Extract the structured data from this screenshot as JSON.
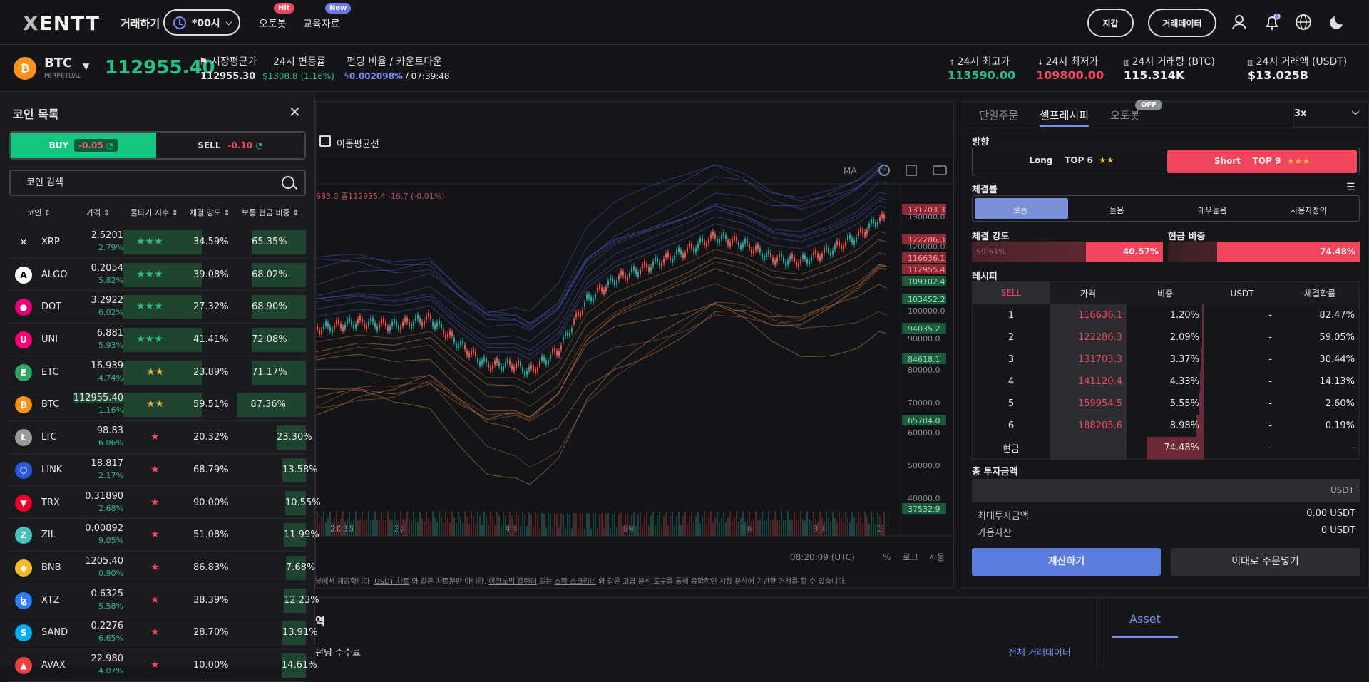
{
  "nav": {
    "logo_x": "X",
    "logo_text": "ENTT",
    "trade": "거래하기",
    "hour": "*00시",
    "autobot": "오토봇",
    "autobot_badge": "Hit",
    "edu": "교육자료",
    "edu_badge": "New",
    "wallet": "지갑",
    "tradedata": "거래데이터"
  },
  "ticker": {
    "symbol": "BTC",
    "sub": "PERPETUAL",
    "last": "112955.40",
    "mark_label": "시장평균가",
    "mark_value": "112955.30",
    "chg_label": "24시 변동률",
    "chg_value": "$1308.8 (1.16%)",
    "funding_label": "펀딩 비율 / 카운트다운",
    "funding_rate": "0.002098%",
    "funding_count": "/ 07:39:48",
    "high_label": "24시 최고가",
    "high_value": "113590.00",
    "low_label": "24시 최저가",
    "low_value": "109800.00",
    "vol_btc_label": "24시 거래량 (BTC)",
    "vol_btc_value": "115.314K",
    "vol_usdt_label": "24시 거래액 (USDT)",
    "vol_usdt_value": "$13.025B"
  },
  "coinlist": {
    "title": "코인 목록",
    "buy": "BUY",
    "buy_chip": "-0.05",
    "sell": "SELL",
    "sell_chip": "-0.10",
    "search_placeholder": "코인 검색",
    "headers": [
      "코인 ⇕",
      "가격 ⇕",
      "물타기 지수 ⇕",
      "체결 강도 ⇕",
      "보통 현금 비중 ⇕"
    ],
    "rows": [
      {
        "name": "XRP",
        "price": "2.5201",
        "pct": "2.79%",
        "stars": "★★★",
        "strength": "34.59%",
        "cash": "65.35%",
        "icon": "✕",
        "color": "#1a1b1f",
        "starcolor": "#2ebd85",
        "cashw": 0.62
      },
      {
        "name": "ALGO",
        "price": "0.2054",
        "pct": "5.82%",
        "stars": "★★★",
        "strength": "39.08%",
        "cash": "68.02%",
        "icon": "A",
        "color": "#ffffff",
        "starcolor": "#2ebd85",
        "cashw": 0.62
      },
      {
        "name": "DOT",
        "price": "3.2922",
        "pct": "6.02%",
        "stars": "★★★",
        "strength": "27.32%",
        "cash": "68.90%",
        "icon": "●",
        "color": "#e6007a",
        "starcolor": "#2ebd85",
        "cashw": 0.62
      },
      {
        "name": "UNI",
        "price": "6.881",
        "pct": "5.93%",
        "stars": "★★★",
        "strength": "41.41%",
        "cash": "72.08%",
        "icon": "U",
        "color": "#ff007a",
        "starcolor": "#2ebd85",
        "cashw": 0.62
      },
      {
        "name": "ETC",
        "price": "16.939",
        "pct": "4.74%",
        "stars": "★★",
        "strength": "23.89%",
        "cash": "71.17%",
        "icon": "E",
        "color": "#33a466",
        "starcolor": "#e8b64a",
        "cashw": 0.62
      },
      {
        "name": "BTC",
        "price": "112955.40",
        "pct": "1.16%",
        "stars": "★★",
        "strength": "59.51%",
        "cash": "87.36%",
        "icon": "₿",
        "color": "#f7931a",
        "starcolor": "#e8b64a",
        "cashw": 0.85
      },
      {
        "name": "LTC",
        "price": "98.83",
        "pct": "6.06%",
        "stars": "★",
        "strength": "20.32%",
        "cash": "23.30%",
        "icon": "Ł",
        "color": "#9a9a9a",
        "starcolor": "#f6465d",
        "cashw": 0.23
      },
      {
        "name": "LINK",
        "price": "18.817",
        "pct": "2.17%",
        "stars": "★",
        "strength": "68.79%",
        "cash": "13.58%",
        "icon": "⬡",
        "color": "#2a5ada",
        "starcolor": "#f6465d",
        "cashw": 0.14
      },
      {
        "name": "TRX",
        "price": "0.31890",
        "pct": "2.68%",
        "stars": "★",
        "strength": "90.00%",
        "cash": "10.55%",
        "icon": "▼",
        "color": "#eb0029",
        "starcolor": "#f6465d",
        "cashw": 0.1
      },
      {
        "name": "ZIL",
        "price": "0.00892",
        "pct": "9.05%",
        "stars": "★",
        "strength": "51.08%",
        "cash": "11.99%",
        "icon": "Z",
        "color": "#49c1bf",
        "starcolor": "#f6465d",
        "cashw": 0.12
      },
      {
        "name": "BNB",
        "price": "1205.40",
        "pct": "0.90%",
        "stars": "★",
        "strength": "86.83%",
        "cash": "7.68%",
        "icon": "◆",
        "color": "#f3ba2f",
        "starcolor": "#f6465d",
        "cashw": 0.07
      },
      {
        "name": "XTZ",
        "price": "0.6325",
        "pct": "5.58%",
        "stars": "★",
        "strength": "38.39%",
        "cash": "12.23%",
        "icon": "ꜩ",
        "color": "#2c7df7",
        "starcolor": "#f6465d",
        "cashw": 0.12
      },
      {
        "name": "SAND",
        "price": "0.2276",
        "pct": "6.65%",
        "stars": "★",
        "strength": "28.70%",
        "cash": "13.91%",
        "icon": "S",
        "color": "#04adef",
        "starcolor": "#f6465d",
        "cashw": 0.14
      },
      {
        "name": "AVAX",
        "price": "22.980",
        "pct": "4.07%",
        "stars": "★",
        "strength": "10.00%",
        "cash": "14.61%",
        "icon": "▲",
        "color": "#e84142",
        "starcolor": "#f6465d",
        "cashw": 0.15
      }
    ]
  },
  "chart": {
    "ma_label": "이동평균선",
    "ma_btn": "MA",
    "legend": "683.0 종112955.4 -16.7 (-0.01%)",
    "price_labels": [
      {
        "v": "131703.3",
        "tag": "red"
      },
      {
        "v": "130000.0",
        "tag": ""
      },
      {
        "v": "122286.3",
        "tag": "red"
      },
      {
        "v": "120000.0",
        "tag": ""
      },
      {
        "v": "116636.1",
        "tag": "red"
      },
      {
        "v": "112955.4",
        "tag": "red"
      },
      {
        "v": "109102.4",
        "tag": "green"
      },
      {
        "v": "103452.2",
        "tag": "green"
      },
      {
        "v": "100000.0",
        "tag": ""
      },
      {
        "v": "94035.2",
        "tag": "green"
      },
      {
        "v": "90000.0",
        "tag": ""
      },
      {
        "v": "84618.1",
        "tag": "green"
      },
      {
        "v": "80000.0",
        "tag": ""
      },
      {
        "v": "70000.0",
        "tag": ""
      },
      {
        "v": "65784.0",
        "tag": "green"
      },
      {
        "v": "60000.0",
        "tag": ""
      },
      {
        "v": "50000.0",
        "tag": ""
      },
      {
        "v": "40000.0",
        "tag": ""
      },
      {
        "v": "37532.9",
        "tag": "green"
      }
    ],
    "time_labels": [
      "2025",
      "2월",
      "4월",
      "6월",
      "8월",
      "9월",
      "2"
    ],
    "clock": "08:20:09 (UTC)",
    "pct_btn": "%",
    "log_btn": "로그",
    "auto_btn": "자동",
    "note_a": "뷰에서 제공합니다.",
    "note_link1": "USDT 차트",
    "note_b": "와 같은 차트뿐만 아니라,",
    "note_link2": "이코노믹 캘린더",
    "note_c": "또는",
    "note_link3": "스탁 스크리너",
    "note_d": "와 같은 고급 분석 도구를 통해 종합적인 시장 분석에 기반한 거래를 할 수 있습니다."
  },
  "right": {
    "tab1": "단일주문",
    "tab2": "셀프레시피",
    "tab3": "오토봇",
    "tab3_badge": "OFF",
    "leverage": "3x",
    "dir_label": "방향",
    "long": "Long",
    "long_top": "TOP 6",
    "long_stars": "★★",
    "short": "Short",
    "short_top": "TOP 9",
    "short_stars": "★★★",
    "fill_label": "체결률",
    "fill_opts": [
      "보통",
      "높음",
      "매우높음",
      "사용자정의"
    ],
    "strength_label": "체결 강도",
    "strength_left": "59.51%",
    "strength_right": "40.57%",
    "cash_label": "현금 비중",
    "cash_right": "74.48%",
    "recipe_label": "레시피",
    "table_head": [
      "SELL",
      "가격",
      "비중",
      "USDT",
      "체결확률"
    ],
    "table_rows": [
      {
        "n": "1",
        "price": "116636.1",
        "ratio": "1.20%",
        "usdt": "-",
        "prob": "82.47%",
        "w": 0.012
      },
      {
        "n": "2",
        "price": "122286.3",
        "ratio": "2.09%",
        "usdt": "-",
        "prob": "59.05%",
        "w": 0.021
      },
      {
        "n": "3",
        "price": "131703.3",
        "ratio": "3.37%",
        "usdt": "-",
        "prob": "30.44%",
        "w": 0.034
      },
      {
        "n": "4",
        "price": "141120.4",
        "ratio": "4.33%",
        "usdt": "-",
        "prob": "14.13%",
        "w": 0.043
      },
      {
        "n": "5",
        "price": "159954.5",
        "ratio": "5.55%",
        "usdt": "-",
        "prob": "2.60%",
        "w": 0.056
      },
      {
        "n": "6",
        "price": "188205.6",
        "ratio": "8.98%",
        "usdt": "-",
        "prob": "0.19%",
        "w": 0.09
      },
      {
        "n": "현금",
        "price": "-",
        "ratio": "74.48%",
        "usdt": "-",
        "prob": "-",
        "w": 0.745
      }
    ],
    "total_label": "총 투자금액",
    "total_unit": "USDT",
    "max_label": "최대투자금액",
    "max_value": "0.00 USDT",
    "avail_label": "가용자산",
    "avail_value": "0 USDT",
    "calc": "계산하기",
    "order": "이대로 주문넣기"
  },
  "bottom": {
    "title_frag": "역",
    "funding_frag": "펀딩 수수료",
    "all_data": "전체 거래데이터",
    "asset_tab": "Asset"
  }
}
